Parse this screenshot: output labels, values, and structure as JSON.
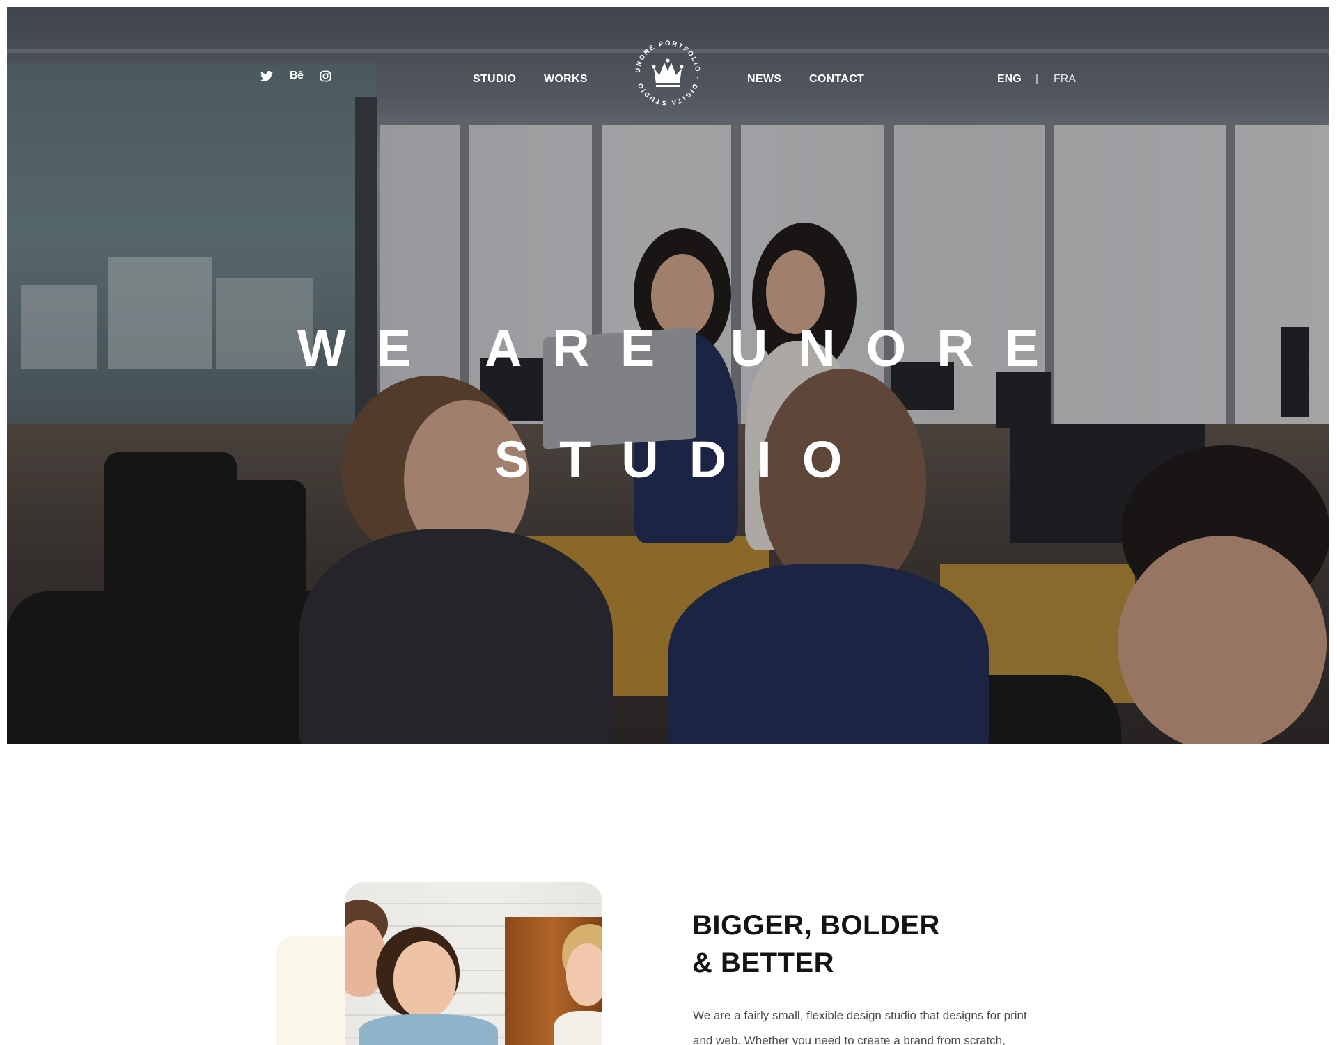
{
  "nav": {
    "social": [
      {
        "icon": "twitter-icon"
      },
      {
        "icon": "behance-icon",
        "label": "Bē"
      },
      {
        "icon": "instagram-icon"
      }
    ],
    "links_left": [
      "STUDIO",
      "WORKS"
    ],
    "links_right": [
      "NEWS",
      "CONTACT"
    ],
    "logo": {
      "ring_text": "UNORE PORTFOLIO · DIGITA STUDIO",
      "icon": "crown-icon"
    },
    "languages": {
      "active": "ENG",
      "separator": "|",
      "other": "FRA"
    }
  },
  "hero": {
    "title_line1": "WE ARE UNORE",
    "title_line2": "STUDIO"
  },
  "about": {
    "heading_line1": "BIGGER, BOLDER",
    "heading_line2": "& BETTER",
    "text_line1": "We are a fairly small, flexible design studio that designs for print",
    "text_line2": "and web. Whether you need to create a brand from scratch,"
  },
  "colors": {
    "accent_bg": "#fbf6ea",
    "heading": "#141414",
    "body_text": "#4a4a4a"
  }
}
